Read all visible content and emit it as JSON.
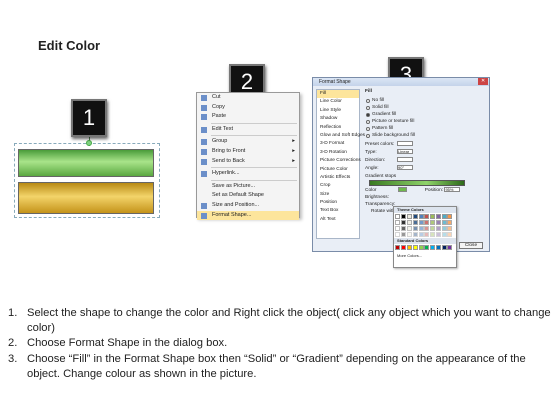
{
  "title": "Edit Color",
  "badges": [
    "1",
    "2",
    "3"
  ],
  "context_menu": {
    "items": [
      {
        "label": "Cut",
        "icon": "scissors-icon"
      },
      {
        "label": "Copy",
        "icon": "copy-icon"
      },
      {
        "label": "Paste",
        "icon": "paste-icon"
      },
      {
        "label": "Edit Text",
        "icon": "text-icon"
      },
      {
        "label": "Group",
        "icon": "group-icon",
        "submenu": true
      },
      {
        "label": "Bring to Front",
        "icon": "bring-front-icon",
        "submenu": true
      },
      {
        "label": "Send to Back",
        "icon": "send-back-icon",
        "submenu": true
      },
      {
        "label": "Hyperlink...",
        "icon": "hyperlink-icon"
      },
      {
        "label": "Save as Picture...",
        "icon": ""
      },
      {
        "label": "Set as Default Shape",
        "icon": ""
      },
      {
        "label": "Size and Position...",
        "icon": "size-icon"
      },
      {
        "label": "Format Shape...",
        "icon": "format-shape-icon",
        "selected": true
      }
    ]
  },
  "format_dialog": {
    "title": "Format Shape",
    "categories": [
      "Fill",
      "Line Color",
      "Line Style",
      "Shadow",
      "Reflection",
      "Glow and Soft Edges",
      "3-D Format",
      "3-D Rotation",
      "Picture Corrections",
      "Picture Color",
      "Artistic Effects",
      "Crop",
      "Size",
      "Position",
      "Text Box",
      "Alt Text"
    ],
    "heading": "Fill",
    "fill_options": [
      "No fill",
      "Solid fill",
      "Gradient fill",
      "Picture or texture fill",
      "Pattern fill",
      "Slide background fill"
    ],
    "selected_fill": "Gradient fill",
    "fields": [
      {
        "label": "Preset colors:",
        "value": ""
      },
      {
        "label": "Type:",
        "value": "Linear"
      },
      {
        "label": "Direction:",
        "value": ""
      },
      {
        "label": "Angle:",
        "value": "90°"
      }
    ],
    "gradient_stops_label": "Gradient stops",
    "color_label": "Color",
    "position_label": "Position:",
    "position_value": "95%",
    "brightness_label": "Brightness:",
    "transparency_label": "Transparency:",
    "rotate_label": "Rotate with shape",
    "close_label": "Close"
  },
  "palette": {
    "theme_label": "Theme Colors",
    "standard_label": "Standard Colors",
    "more_label": "More Colors...",
    "theme_colors": [
      "#ffffff",
      "#000000",
      "#eeece1",
      "#1f497d",
      "#4f81bd",
      "#c0504d",
      "#9bbb59",
      "#8064a2",
      "#4bacc6",
      "#f79646"
    ],
    "standard_colors": [
      "#c00000",
      "#ff0000",
      "#ffc000",
      "#ffff00",
      "#92d050",
      "#00b050",
      "#00b0f0",
      "#0070c0",
      "#002060",
      "#7030a0"
    ]
  },
  "steps": [
    {
      "num": "1.",
      "text": "Select the shape to change the color and Right click the object( click any object which you want to change color)"
    },
    {
      "num": "2.",
      "text": "Choose Format Shape in the dialog box."
    },
    {
      "num": "3.",
      "text": "Choose “Fill” in the Format Shape box then “Solid” or “Gradient” depending on the appearance of the object. Change colour as shown in the picture."
    }
  ]
}
